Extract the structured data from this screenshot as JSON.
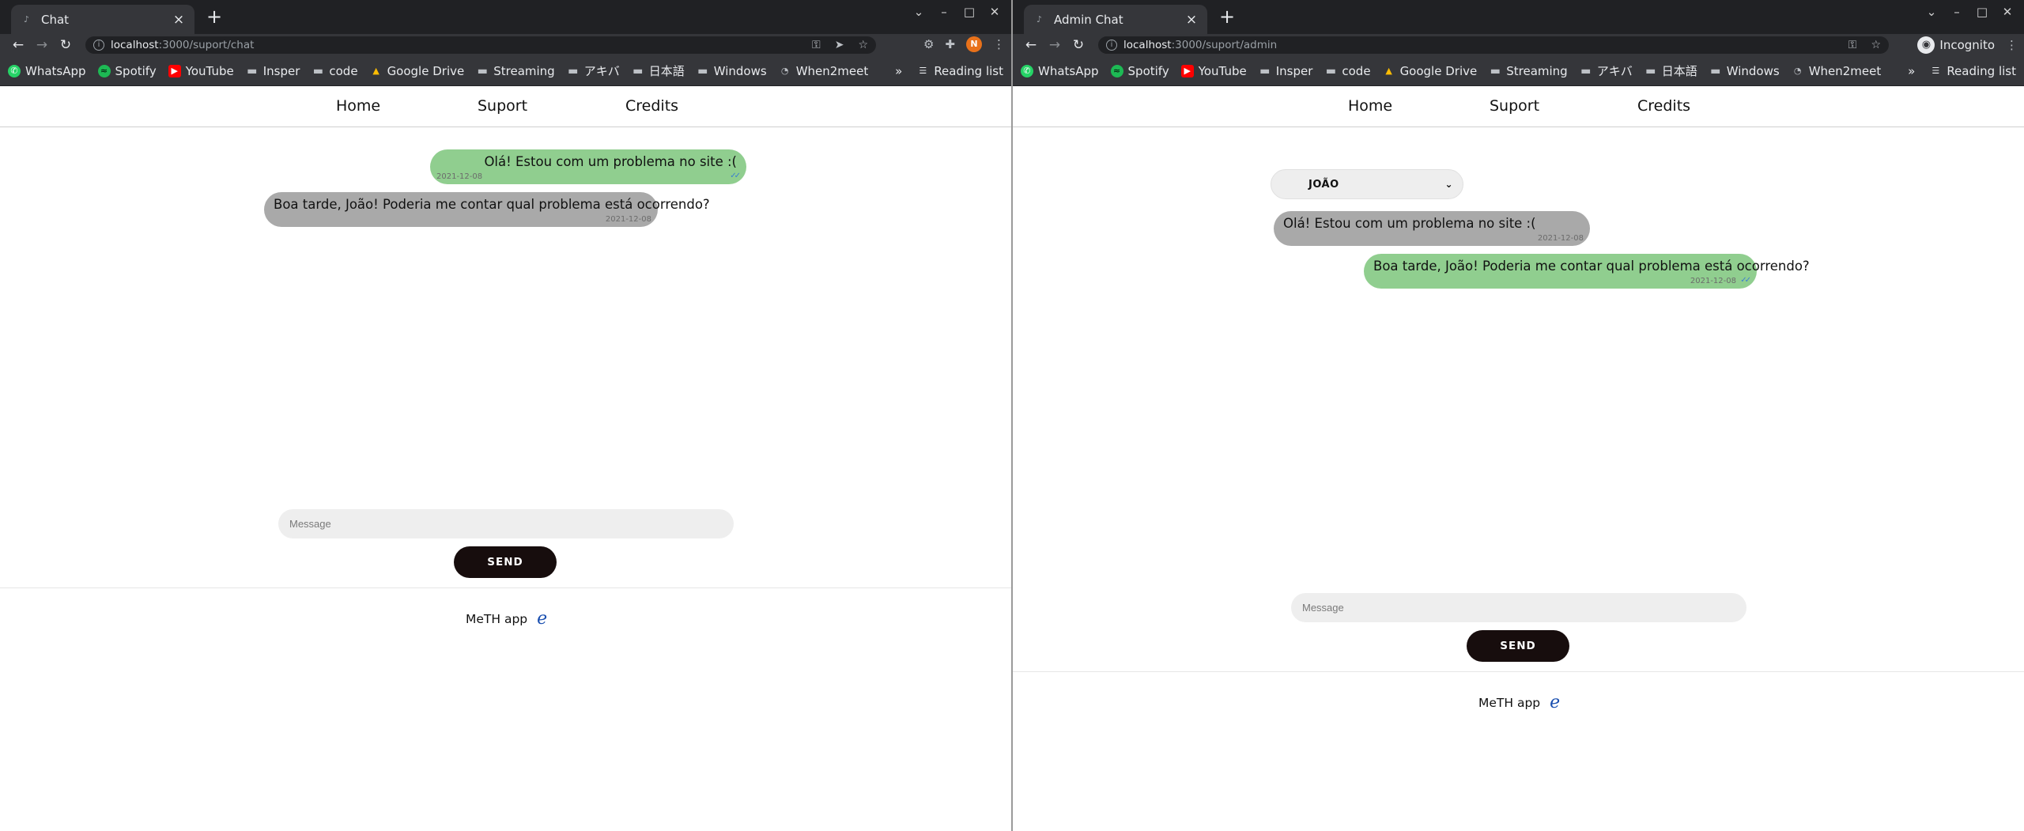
{
  "left": {
    "tab_title": "Chat",
    "url_host": "localhost",
    "url_path": ":3000/suport/chat",
    "profile_initial": "N",
    "messages": [
      {
        "text": "Olá! Estou com um problema no site :(",
        "date": "2021-12-08"
      },
      {
        "text": "Boa tarde, João! Poderia me contar qual problema está ocorrendo?",
        "date": "2021-12-08"
      }
    ],
    "input_placeholder": "Message",
    "send_label": "SEND",
    "footer_text": "MeTH app",
    "footer_logo": "e"
  },
  "right": {
    "tab_title": "Admin Chat",
    "url_host": "localhost",
    "url_path": ":3000/suport/admin",
    "incognito_label": "Incognito",
    "selected_user": "JOÃO",
    "messages": [
      {
        "text": "Olá! Estou com um problema no site :(",
        "date": "2021-12-08"
      },
      {
        "text": "Boa tarde, João! Poderia me contar qual problema está ocorrendo?",
        "date": "2021-12-08"
      }
    ],
    "input_placeholder": "Message",
    "send_label": "SEND",
    "footer_text": "MeTH app",
    "footer_logo": "e"
  },
  "site_nav": {
    "home": "Home",
    "suport": "Suport",
    "credits": "Credits"
  },
  "bookmarks": {
    "items": [
      {
        "label": "WhatsApp",
        "icon": "whatsapp-icon"
      },
      {
        "label": "Spotify",
        "icon": "spotify-icon"
      },
      {
        "label": "YouTube",
        "icon": "youtube-icon"
      },
      {
        "label": "Insper",
        "icon": "folder-icon"
      },
      {
        "label": "code",
        "icon": "folder-icon"
      },
      {
        "label": "Google Drive",
        "icon": "google-drive-icon"
      },
      {
        "label": "Streaming",
        "icon": "folder-icon"
      },
      {
        "label": "アキバ",
        "icon": "folder-icon"
      },
      {
        "label": "日本語",
        "icon": "folder-icon"
      },
      {
        "label": "Windows",
        "icon": "folder-icon"
      },
      {
        "label": "When2meet",
        "icon": "when2meet-icon"
      }
    ],
    "more": "»",
    "reading_list": "Reading list"
  },
  "colors": {
    "sent_bubble": "#90ce8f",
    "received_bubble": "#a9a9a9",
    "send_button": "#170d0d",
    "footer_logo": "#1a4fb0"
  }
}
